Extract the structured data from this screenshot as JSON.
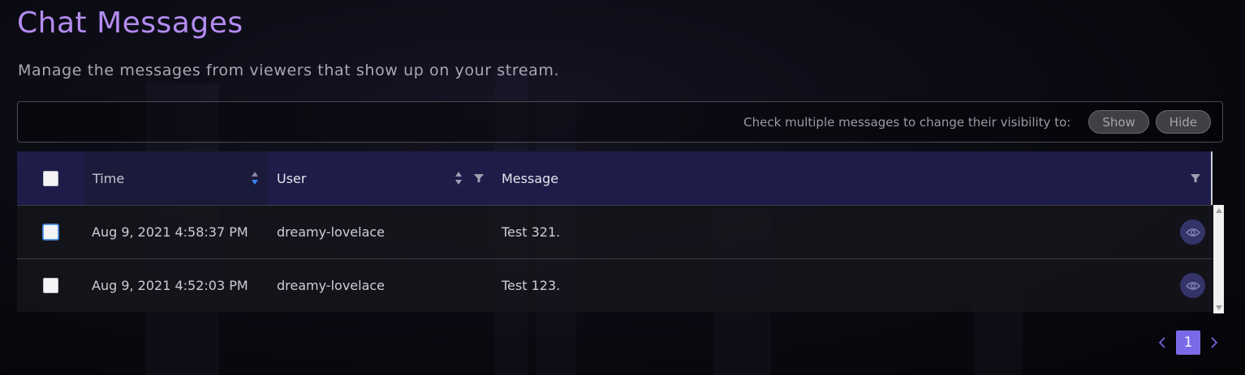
{
  "header": {
    "title": "Chat Messages",
    "subtitle": "Manage the messages from viewers that show up on your stream."
  },
  "bulk": {
    "hint": "Check multiple messages to change their visibility to:",
    "show_label": "Show",
    "hide_label": "Hide"
  },
  "table": {
    "columns": {
      "time": "Time",
      "user": "User",
      "message": "Message"
    },
    "sort": {
      "column": "time",
      "direction": "descending"
    },
    "rows": [
      {
        "time": "Aug 9, 2021 4:58:37 PM",
        "user": "dreamy-lovelace",
        "message": "Test 321.",
        "checked": false
      },
      {
        "time": "Aug 9, 2021 4:52:03 PM",
        "user": "dreamy-lovelace",
        "message": "Test 123.",
        "checked": false
      }
    ]
  },
  "pagination": {
    "current_page": "1",
    "prev_icon": "chevron-left-icon",
    "next_icon": "chevron-right-icon"
  },
  "colors": {
    "title": "#b48cf0",
    "header_bg": "#1e1c48",
    "active_page": "#7b6ae8",
    "sort_active": "#3b82f6"
  }
}
